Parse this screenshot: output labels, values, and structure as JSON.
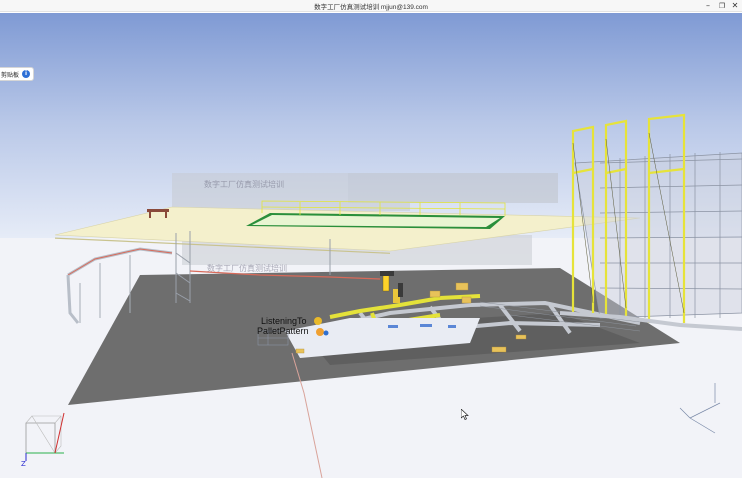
{
  "window": {
    "title": "数字工厂仿真测试培训 mjjun@139.com",
    "minimize_glyph": "–",
    "maximize_glyph": "❐",
    "close_glyph": "✕"
  },
  "sidebar": {
    "clipboard_label": "剪贴板",
    "info_glyph": "i"
  },
  "scene": {
    "watermark_upper": "数字工厂仿真测试培训",
    "watermark_lower": "数字工厂仿真测试培训",
    "object_label_1": "ListeningTo",
    "object_label_2": "PalletPattern"
  },
  "orientation_cube": {
    "z_label": "Z"
  },
  "icons": {
    "window_controls": [
      "minimize-icon",
      "maximize-icon",
      "close-icon"
    ],
    "info": "info-icon",
    "cursor": "mouse-cursor-icon"
  },
  "colors": {
    "sky_top": "#7f9ad4",
    "sky_bottom": "#eef2fa",
    "floor": "#6e6e6e",
    "rack_yellow": "#e6e33a",
    "rack_grey": "#8b93a3",
    "platform": "#f4f0cc",
    "accent_blue": "#2d6fd6"
  }
}
